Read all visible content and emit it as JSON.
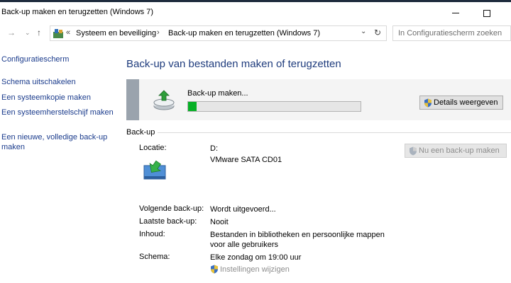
{
  "window": {
    "title": "Back-up maken en terugzetten (Windows 7)",
    "minimize_glyph": "—",
    "maximize_glyph": "□"
  },
  "nav": {
    "breadcrumb_prefix": "«",
    "breadcrumbs": [
      "Systeem en beveiliging",
      "Back-up maken en terugzetten (Windows 7)"
    ],
    "breadcrumb_separator": "›",
    "search_placeholder": "In Configuratiescherm zoeken"
  },
  "sidebar": {
    "home_label": "Configuratiescherm",
    "items": [
      {
        "label": "Schema uitschakelen"
      },
      {
        "label": "Een systeemkopie maken"
      },
      {
        "label": "Een systeemherstelschijf maken"
      },
      {
        "label": "Een nieuwe, volledige back-up maken"
      }
    ]
  },
  "main": {
    "title": "Back-up van bestanden maken of terugzetten",
    "progress": {
      "status_text": "Back-up maken...",
      "percent": 5,
      "details_button": "Details weergeven"
    },
    "backup_section": {
      "label": "Back-up",
      "location_label": "Locatie:",
      "location_drive": "D:",
      "location_device": "VMware SATA CD01",
      "backup_now_button": "Nu een back-up maken",
      "next_label": "Volgende back-up:",
      "next_value": "Wordt uitgevoerd...",
      "last_label": "Laatste back-up:",
      "last_value": "Nooit",
      "contents_label": "Inhoud:",
      "contents_value": "Bestanden in bibliotheken en persoonlijke mappen voor alle gebruikers",
      "schedule_label": "Schema:",
      "schedule_value": "Elke zondag om 19:00 uur",
      "change_settings_link": "Instellingen wijzigen"
    }
  },
  "colors": {
    "link": "#1a3b8c",
    "title": "#1f3c7d",
    "progress_fill": "#06b025",
    "disabled_text": "#8d8d8d"
  }
}
